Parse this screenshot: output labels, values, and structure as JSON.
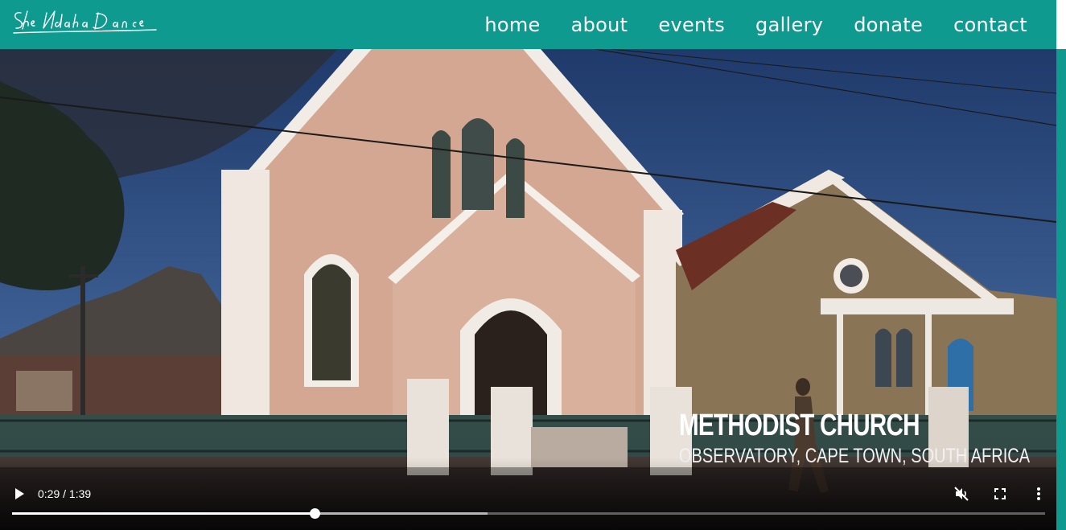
{
  "brand": {
    "logo_text": "SheNdaba Dance",
    "color": "#0e9a8f"
  },
  "nav": {
    "items": [
      {
        "label": "home"
      },
      {
        "label": "about"
      },
      {
        "label": "events"
      },
      {
        "label": "gallery"
      },
      {
        "label": "donate"
      },
      {
        "label": "contact"
      }
    ]
  },
  "video": {
    "caption_title": "METHODIST CHURCH",
    "caption_subtitle": "OBSERVATORY, CAPE TOWN, SOUTH AFRICA",
    "time_display": "0:29 / 1:39",
    "current_seconds": 29,
    "duration_seconds": 99,
    "buffered_fraction": 0.46,
    "muted": true,
    "icons": {
      "play": "play-icon",
      "mute": "muted-speaker-icon",
      "fullscreen": "fullscreen-icon",
      "more": "more-vertical-icon"
    }
  }
}
